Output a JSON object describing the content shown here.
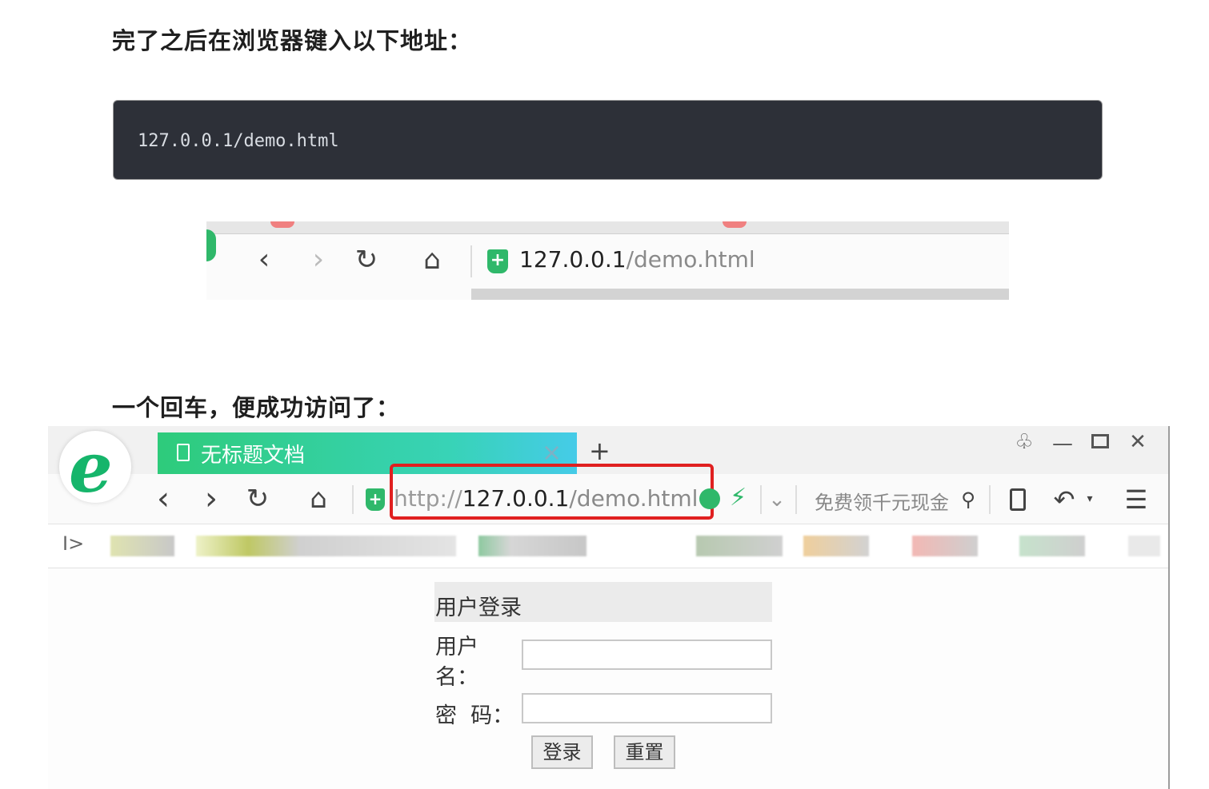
{
  "heading1": "完了之后在浏览器键入以下地址：",
  "code": "127.0.0.1/demo.html",
  "shot1": {
    "url_host": "127.0.0.1",
    "url_path": "/demo.html"
  },
  "heading2": "一个回车，便成功访问了：",
  "browser": {
    "tab_title": "无标题文档",
    "tab_close": "×",
    "new_tab": "+",
    "url_scheme": "http://",
    "url_host": "127.0.0.1",
    "url_path": "/demo.html",
    "search_placeholder": "免费领千元现金",
    "sidebar_toggle": "I>"
  },
  "form": {
    "title": "用户登录",
    "username_label_line1": "用户",
    "username_label_line2": "名：",
    "password_label": "密  码：",
    "login_button": "登录",
    "reset_button": "重置",
    "username_value": "",
    "password_value": ""
  },
  "colors": {
    "tab_gradient_start": "#2ecb7b",
    "tab_gradient_end": "#45cbe8",
    "shield_green": "#2fb86a",
    "highlight_red": "#e02020",
    "code_bg": "#2d3038"
  },
  "icons": [
    "back-icon",
    "forward-icon",
    "refresh-icon",
    "home-icon",
    "shield-icon",
    "lightning-icon",
    "search-icon",
    "mobile-icon",
    "undo-icon",
    "menu-icon",
    "skin-icon",
    "minimize-icon",
    "maximize-icon",
    "close-icon",
    "document-icon"
  ]
}
